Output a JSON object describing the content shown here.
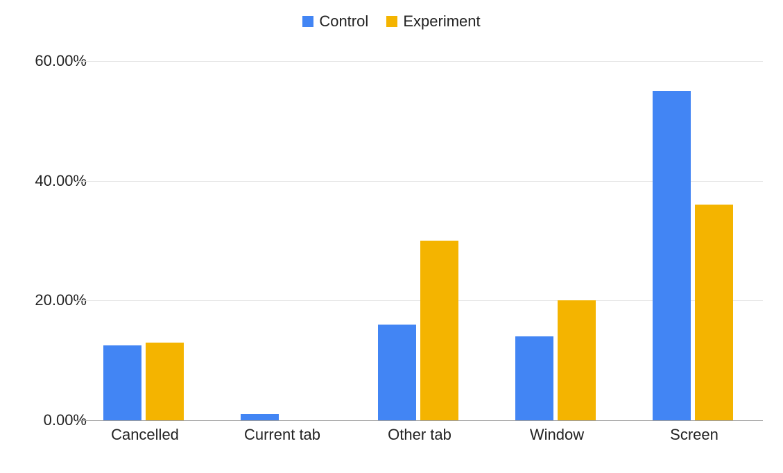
{
  "legend": {
    "series": [
      {
        "name": "Control",
        "color": "#4285f4"
      },
      {
        "name": "Experiment",
        "color": "#f4b400"
      }
    ]
  },
  "chart_data": {
    "type": "bar",
    "categories": [
      "Cancelled",
      "Current tab",
      "Other tab",
      "Window",
      "Screen"
    ],
    "series": [
      {
        "name": "Control",
        "values": [
          12.5,
          1.0,
          16.0,
          14.0,
          55.0
        ]
      },
      {
        "name": "Experiment",
        "values": [
          13.0,
          0.0,
          30.0,
          20.0,
          36.0
        ]
      }
    ],
    "ylim": [
      0,
      60
    ],
    "y_tick_values": [
      0,
      20,
      40,
      60
    ],
    "y_tick_labels": [
      "0.00%",
      "20.00%",
      "40.00%",
      "60.00%"
    ],
    "y_format": "percent_two_decimal"
  }
}
